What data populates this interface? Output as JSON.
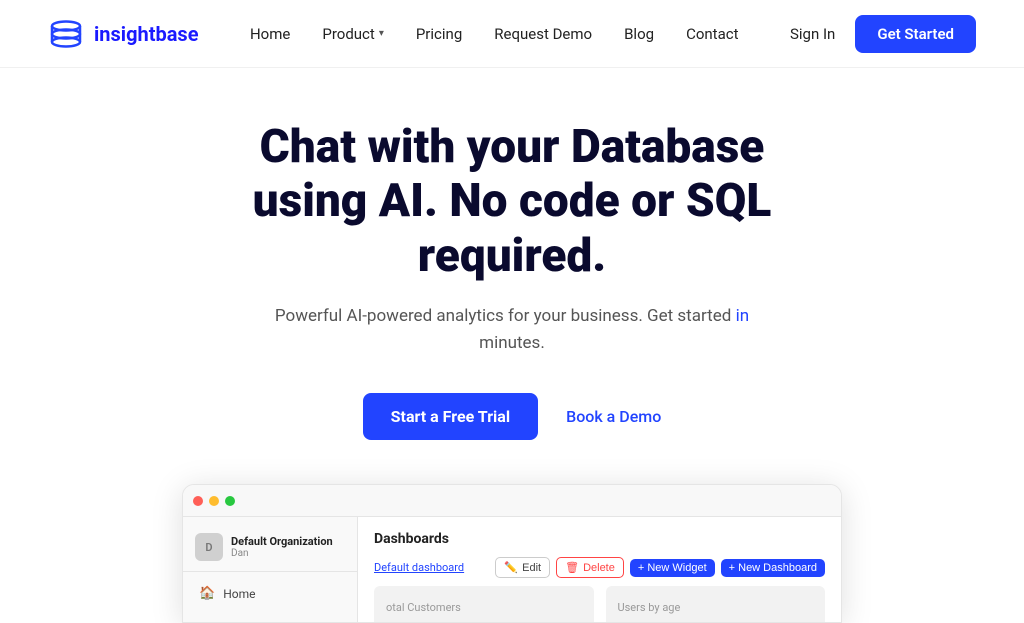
{
  "brand": {
    "name": "insightbase",
    "logo_alt": "insightbase logo"
  },
  "nav": {
    "items": [
      {
        "label": "Home",
        "id": "home",
        "has_dropdown": false
      },
      {
        "label": "Product",
        "id": "product",
        "has_dropdown": true
      },
      {
        "label": "Pricing",
        "id": "pricing",
        "has_dropdown": false
      },
      {
        "label": "Request Demo",
        "id": "request-demo",
        "has_dropdown": false
      },
      {
        "label": "Blog",
        "id": "blog",
        "has_dropdown": false
      },
      {
        "label": "Contact",
        "id": "contact",
        "has_dropdown": false
      }
    ],
    "sign_in": "Sign In",
    "get_started": "Get Started"
  },
  "hero": {
    "title": "Chat with your Database using AI. No code or SQL required.",
    "subtitle_part1": "Powerful AI-powered analytics for your business. Get started ",
    "subtitle_highlight": "in",
    "subtitle_part2": " minutes.",
    "cta_primary": "Start a Free Trial",
    "cta_secondary": "Book a Demo"
  },
  "dashboard_preview": {
    "sidebar": {
      "org_name": "Default Organization",
      "org_user": "Dan",
      "nav_items": [
        {
          "label": "Home",
          "icon": "🏠"
        }
      ]
    },
    "main": {
      "section_title": "Dashboards",
      "default_dashboard_link": "Default dashboard",
      "btn_edit": "Edit",
      "btn_delete": "Delete",
      "btn_new_widget": "+ New Widget",
      "btn_new_dashboard": "+ New Dashboard",
      "content_placeholders": [
        {
          "label": "otal Customers"
        },
        {
          "label": "Users by age"
        }
      ]
    }
  }
}
